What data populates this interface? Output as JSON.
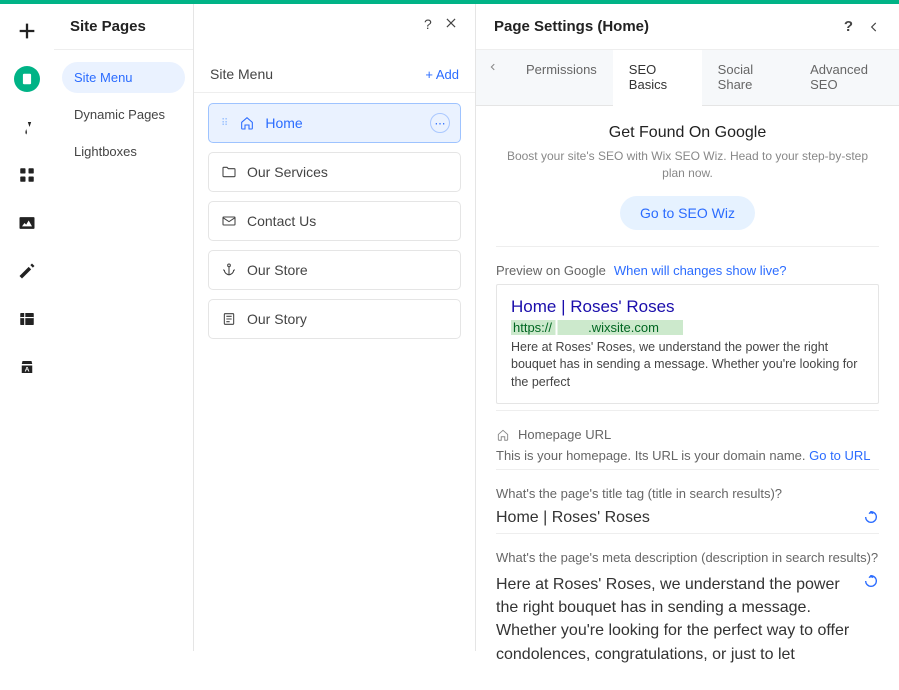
{
  "left_panel_title": "Site Pages",
  "right_panel_title": "Page Settings (Home)",
  "sidebar": {
    "items": [
      {
        "label": "Site Menu"
      },
      {
        "label": "Dynamic Pages"
      },
      {
        "label": "Lightboxes"
      }
    ]
  },
  "site_menu": {
    "heading": "Site Menu",
    "add_label": "+ Add",
    "pages": [
      {
        "label": "Home"
      },
      {
        "label": "Our Services"
      },
      {
        "label": "Contact Us"
      },
      {
        "label": "Our Store"
      },
      {
        "label": "Our Story"
      }
    ]
  },
  "tabs": {
    "permissions": "Permissions",
    "seo_basics": "SEO Basics",
    "social_share": "Social Share",
    "advanced_seo": "Advanced SEO"
  },
  "hero": {
    "title": "Get Found On Google",
    "subtitle": "Boost your site's SEO with Wix SEO Wiz. Head to your step-by-step plan now.",
    "cta": "Go to SEO Wiz"
  },
  "preview": {
    "label": "Preview on Google",
    "link": "When will changes show live?",
    "g_title": "Home | Roses' Roses",
    "g_url_prefix": "https://",
    "g_url_mid": ".wixsite.com",
    "g_desc": "Here at Roses' Roses, we understand the power the right bouquet has in sending a message. Whether you're looking for the perfect"
  },
  "homepage": {
    "label": "Homepage URL",
    "text_before": "This is your homepage. Its URL is your domain name. ",
    "link": "Go to URL"
  },
  "title_tag": {
    "label": "What's the page's title tag (title in search results)?",
    "value": "Home | Roses' Roses"
  },
  "meta_desc": {
    "label": "What's the page's meta description (description in search results)?",
    "value": "Here at Roses' Roses, we understand the power the right bouquet has in sending a message. Whether you're looking for the perfect way to offer condolences, congratulations, or just to let"
  }
}
